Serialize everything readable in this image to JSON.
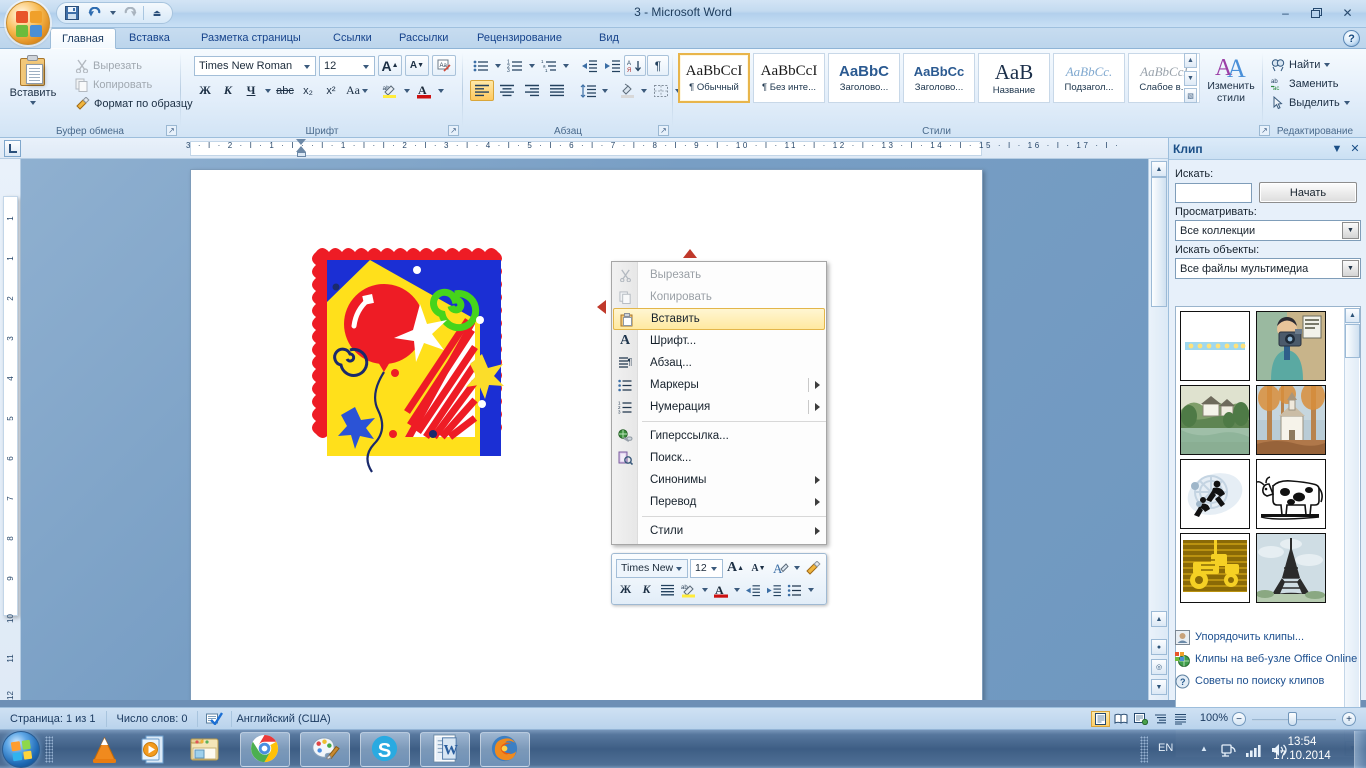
{
  "window": {
    "title": "3 - Microsoft Word",
    "minimize": "–",
    "restore": "❐",
    "close": "✕",
    "help": "?"
  },
  "quick_access": {
    "save": "save-icon",
    "undo": "undo-icon",
    "redo": "redo-icon",
    "customize": "customize-icon"
  },
  "ribbon": {
    "tabs": [
      {
        "label": "Главная",
        "active": true
      },
      {
        "label": "Вставка",
        "active": false
      },
      {
        "label": "Разметка страницы",
        "active": false
      },
      {
        "label": "Ссылки",
        "active": false
      },
      {
        "label": "Рассылки",
        "active": false
      },
      {
        "label": "Рецензирование",
        "active": false
      },
      {
        "label": "Вид",
        "active": false
      }
    ],
    "clipboard": {
      "group_label": "Буфер обмена",
      "paste": "Вставить",
      "cut": "Вырезать",
      "copy": "Копировать",
      "format_painter": "Формат по образцу"
    },
    "font": {
      "group_label": "Шрифт",
      "font_name": "Times New Roman",
      "font_size": "12",
      "grow": "A",
      "shrink": "A",
      "clear_format": "Aa",
      "bold": "Ж",
      "italic": "К",
      "underline": "Ч",
      "strike": "abc",
      "subscript": "x₂",
      "superscript": "x²",
      "change_case": "Aa",
      "highlight": "ab",
      "font_color": "A"
    },
    "paragraph": {
      "group_label": "Абзац",
      "bullets": "bullets-icon",
      "numbering": "numbering-icon",
      "multilevel": "multilevel-list-icon",
      "decrease_indent": "decrease-indent-icon",
      "increase_indent": "increase-indent-icon",
      "sort": "sort-icon",
      "show_marks": "¶",
      "align_left": "align-left-icon",
      "align_center": "align-center-icon",
      "align_right": "align-right-icon",
      "justify": "justify-icon",
      "line_spacing": "line-spacing-icon",
      "shading": "shading-icon",
      "borders": "borders-icon"
    },
    "styles": {
      "group_label": "Стили",
      "items": [
        {
          "sample": "AaBbCcI",
          "name": "¶ Обычный",
          "selected": true,
          "color": "#1b1b1b",
          "serif": true,
          "bold": false
        },
        {
          "sample": "AaBbCcI",
          "name": "¶ Без инте...",
          "selected": false,
          "color": "#1b1b1b",
          "serif": true,
          "bold": false
        },
        {
          "sample": "AaBbC",
          "name": "Заголово...",
          "selected": false,
          "color": "#2b5a91",
          "serif": false,
          "bold": true
        },
        {
          "sample": "AaBbCc",
          "name": "Заголово...",
          "selected": false,
          "color": "#2b5a91",
          "serif": false,
          "bold": true
        },
        {
          "sample": "AaB",
          "name": "Название",
          "selected": false,
          "color": "#1b2f4a",
          "serif": true,
          "bold": false
        },
        {
          "sample": "AaBbCc.",
          "name": "Подзагол...",
          "selected": false,
          "color": "#7fa8cf",
          "serif": true,
          "bold": false
        },
        {
          "sample": "AaBbCcI",
          "name": "Слабое в...",
          "selected": false,
          "color": "#9aa3ac",
          "serif": true,
          "bold": false
        }
      ],
      "change_styles": "Изменить\nстили"
    },
    "change_styles_line1": "Изменить",
    "change_styles_line2": "стили",
    "editing": {
      "group_label": "Редактирование",
      "find": "Найти",
      "replace": "Заменить",
      "select": "Выделить"
    }
  },
  "ruler": {
    "corner_tab": "L",
    "horizontal_marks": "3 · I · 2 · I · 1 · I ·    · I · 1 · I · I · 2 · I · 3 · I · 4 · I · 5 · I · 6 · I · 7 · I ·  8 · I · 9 · I · 10 · I · 11 · I · 12 · I · 13 · I · 14 · I · 15 · I · 16 · I · 17 · I ·",
    "vertical_marks": [
      "1",
      "1",
      "2",
      "3",
      "4",
      "5",
      "6",
      "7",
      "8",
      "9",
      "10",
      "11",
      "12"
    ]
  },
  "context_menu": {
    "items": [
      {
        "label": "Вырезать",
        "icon": "scissors-icon",
        "disabled": true,
        "submenu": false,
        "highlighted": false
      },
      {
        "label": "Копировать",
        "icon": "copy-icon",
        "disabled": true,
        "submenu": false,
        "highlighted": false
      },
      {
        "label": "Вставить",
        "icon": "paste-icon",
        "disabled": false,
        "submenu": false,
        "highlighted": true
      },
      {
        "label": "Шрифт...",
        "icon": "font-icon",
        "disabled": false,
        "submenu": false,
        "highlighted": false
      },
      {
        "label": "Абзац...",
        "icon": "paragraph-icon",
        "disabled": false,
        "submenu": false,
        "highlighted": false
      },
      {
        "label": "Маркеры",
        "icon": "bullets-icon",
        "disabled": false,
        "submenu": true,
        "highlighted": false
      },
      {
        "label": "Нумерация",
        "icon": "numbering-icon",
        "disabled": false,
        "submenu": true,
        "highlighted": false
      },
      {
        "label": "Гиперссылка...",
        "icon": "hyperlink-icon",
        "disabled": false,
        "submenu": false,
        "highlighted": false
      },
      {
        "label": "Поиск...",
        "icon": "lookup-icon",
        "disabled": false,
        "submenu": false,
        "highlighted": false
      },
      {
        "label": "Синонимы",
        "icon": "",
        "disabled": false,
        "submenu": true,
        "highlighted": false
      },
      {
        "label": "Перевод",
        "icon": "",
        "disabled": false,
        "submenu": true,
        "highlighted": false
      },
      {
        "label": "Стили",
        "icon": "",
        "disabled": false,
        "submenu": true,
        "highlighted": false
      }
    ]
  },
  "mini_toolbar": {
    "font_name": "Times New",
    "font_size": "12",
    "grow": "A",
    "shrink": "A",
    "font_color_big": "A",
    "format_painter": "format-painter-icon",
    "bold": "Ж",
    "italic": "К",
    "align": "align-center-icon",
    "highlight": "ab",
    "font_color": "A",
    "decrease_indent": "decrease-indent-icon",
    "increase_indent": "increase-indent-icon",
    "bullets": "bullets-icon"
  },
  "task_pane": {
    "title": "Клип",
    "collapse": "▼",
    "close": "✕",
    "search_label": "Искать:",
    "search_value": "",
    "search_button": "Начать",
    "scope_label": "Просматривать:",
    "scope_value": "Все коллекции",
    "types_label": "Искать объекты:",
    "types_value": "Все файлы мультимедиа",
    "results": [
      {
        "name": "blue-dots-divider"
      },
      {
        "name": "photographer-man"
      },
      {
        "name": "village-houses-landscape"
      },
      {
        "name": "church-autumn-trees"
      },
      {
        "name": "running-athletes"
      },
      {
        "name": "cow-engraving"
      },
      {
        "name": "yellow-tractor"
      },
      {
        "name": "eiffel-tower"
      }
    ],
    "links": [
      {
        "label": "Упорядочить клипы...",
        "icon": "organize-clips-icon"
      },
      {
        "label": "Клипы на веб-узле Office Online",
        "icon": "office-online-icon"
      },
      {
        "label": "Советы по поиску клипов",
        "icon": "help-tips-icon"
      }
    ]
  },
  "status_bar": {
    "page": "Страница: 1 из 1",
    "words": "Число слов: 0",
    "proofing_icon": "proofing-icon",
    "language": "Английский (США)",
    "views": [
      "print-layout-icon",
      "full-screen-reading-icon",
      "web-layout-icon",
      "outline-icon",
      "draft-icon"
    ],
    "zoom": "100%",
    "zoom_out": "−",
    "zoom_in": "+"
  },
  "taskbar": {
    "start": "start-orb",
    "items": [
      {
        "name": "vlc-icon",
        "pinned": true
      },
      {
        "name": "media-player-icon",
        "pinned": true
      },
      {
        "name": "explorer-icon",
        "pinned": true
      },
      {
        "name": "chrome-icon",
        "running": true
      },
      {
        "name": "paint-icon",
        "running": true
      },
      {
        "name": "skype-icon",
        "running": true
      },
      {
        "name": "word-icon",
        "running": true
      },
      {
        "name": "firefox-icon",
        "running": true
      }
    ],
    "tray": {
      "language": "EN",
      "show_hidden": "▲",
      "network_icon": "network-icon",
      "signal_icon": "signal-icon",
      "volume_icon": "volume-icon",
      "time": "13:54",
      "date": "17.10.2014"
    }
  }
}
